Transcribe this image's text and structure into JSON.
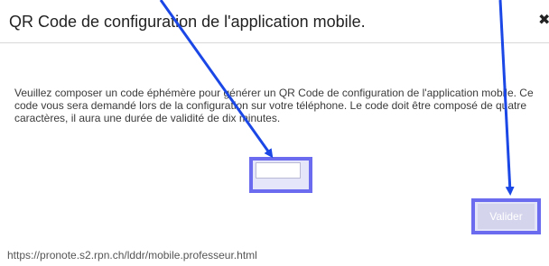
{
  "dialog": {
    "title": "QR Code de configuration de l'application mobile.",
    "close_icon": "close-x-icon",
    "instructions": "Veuillez composer un code éphémère pour générer un QR Code de configuration de l'application mobile. Ce code vous sera demandé lors de la configuration sur votre téléphone. Le code doit être composé de quatre caractères, il aura une durée de validité de dix minutes.",
    "code_input": {
      "value": "",
      "placeholder": ""
    },
    "validate_label": "Valider",
    "footer_url": "https://pronote.s2.rpn.ch/lddr/mobile.professeur.html"
  },
  "annotations": {
    "arrow_color": "#1a47e6",
    "highlight_color": "#6b6bf0",
    "arrow_icon": "arrow-icon"
  }
}
